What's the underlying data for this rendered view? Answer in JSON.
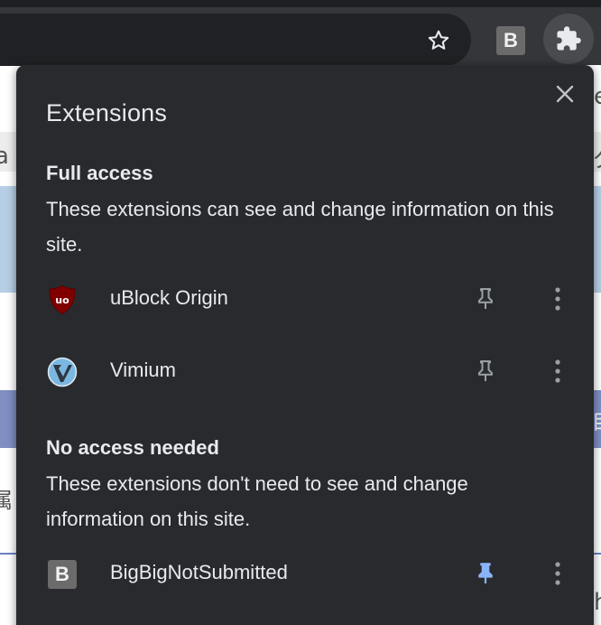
{
  "toolbar": {
    "extension_b_letter": "B",
    "icons": [
      "star-icon",
      "extension-b-icon",
      "puzzle-icon"
    ]
  },
  "background_peek": {
    "left_chars": [
      "a",
      "属"
    ],
    "right_chars": [
      "e",
      "ク",
      "目",
      "h"
    ]
  },
  "popup": {
    "title": "Extensions",
    "sections": [
      {
        "heading": "Full access",
        "description": "These extensions can see and change information on this site.",
        "extensions": [
          {
            "name": "uBlock Origin",
            "icon": "ublock-origin-icon",
            "pinned": false
          },
          {
            "name": "Vimium",
            "icon": "vimium-icon",
            "pinned": false
          }
        ]
      },
      {
        "heading": "No access needed",
        "description": "These extensions don't need to see and change information on this site.",
        "extensions": [
          {
            "name": "BigBigNotSubmitted",
            "icon": "bigbig-icon",
            "icon_letter": "B",
            "pinned": true
          }
        ]
      }
    ]
  },
  "colors": {
    "popup_bg": "#292a2d",
    "text": "#e8eaed",
    "pin_inactive": "#9aa0a6",
    "pin_active": "#8ab4f8",
    "ublock_red": "#800000",
    "vimium_blue": "#7ab8e2"
  }
}
